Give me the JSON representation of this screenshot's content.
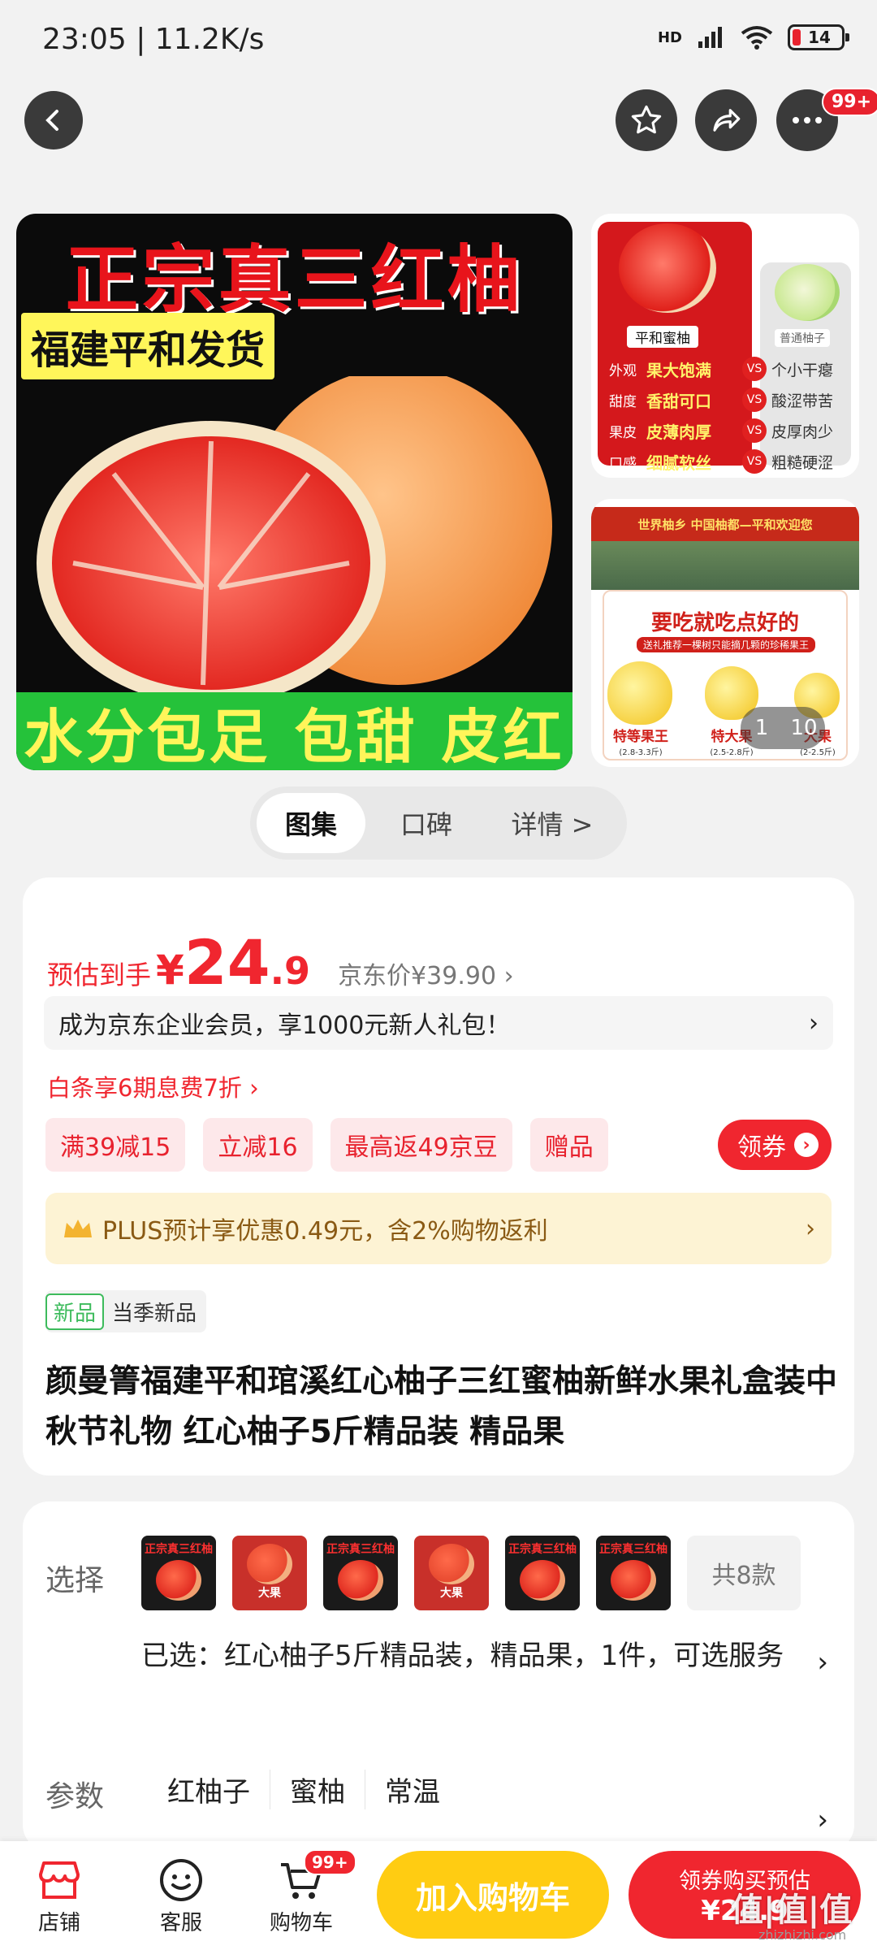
{
  "status": {
    "time": "23:05 | 11.2K/s",
    "network": "HD",
    "battery": "14",
    "battery_color": "#e8222e"
  },
  "topbar": {
    "more_badge": "99+"
  },
  "gallery": {
    "hero_title": "正宗真三红柚",
    "hero_sub": "福建平和发货",
    "hero_bottom": "水分包足 包甜 皮红",
    "thumb1": {
      "left_tag": "平和蜜柚",
      "right_tag": "普通柚子",
      "rows": [
        {
          "k": "外观",
          "v": "果大饱满",
          "o": "个小干瘪"
        },
        {
          "k": "甜度",
          "v": "香甜可口",
          "o": "酸涩带苦"
        },
        {
          "k": "果皮",
          "v": "皮薄肉厚",
          "o": "皮厚肉少"
        },
        {
          "k": "口感",
          "v": "细腻软丝",
          "o": "粗糙硬涩"
        }
      ]
    },
    "thumb2": {
      "banner": "世界柚乡 中国柚都—平和欢迎您",
      "heading": "要吃就吃点好的",
      "subheading": "送礼推荐一棵树只能摘几颗的珍稀果王",
      "grades": [
        {
          "name": "特等果王",
          "weight": "(2.8-3.3斤)"
        },
        {
          "name": "特大果",
          "weight": "(2.5-2.8斤)"
        },
        {
          "name": "大果",
          "weight": "(2-2.5斤)"
        }
      ]
    },
    "pager": {
      "current": "1",
      "total": "10"
    }
  },
  "tabs": [
    {
      "label": "图集"
    },
    {
      "label": "口碑"
    },
    {
      "label": "详情 >"
    }
  ],
  "price": {
    "label": "预估到手",
    "yen": "¥",
    "integer": "24",
    "decimal": ".9",
    "jd_price": "京东价¥39.90 ›"
  },
  "member_banner": {
    "text": "成为京东企业会员，享1000元新人礼包！",
    "arrow": "›"
  },
  "baitiao": "白条享6期息费7折 ›",
  "coupons": [
    "满39减15",
    "立减16",
    "最高返49京豆",
    "赠品"
  ],
  "lingquan": {
    "label": "领券",
    "arrow": "›"
  },
  "plus": {
    "text": "PLUS预计享优惠0.49元，含2%购物返利",
    "arrow": "›"
  },
  "new_tag": {
    "badge": "新品",
    "text": "当季新品"
  },
  "product_title": "颜曼箐福建平和琯溪红心柚子三红蜜柚新鲜水果礼盒装中秋节礼物 红心柚子5斤精品装 精品果",
  "selection": {
    "label": "选择",
    "swatch_caption": "正宗真三红柚",
    "box_caption": "大果",
    "more": "共8款",
    "selected_text": "已选：红心柚子5斤精品装，精品果，1件，可选服务",
    "arrow": "›"
  },
  "params": {
    "label": "参数",
    "items": [
      "红柚子",
      "蜜柚",
      "常温"
    ],
    "arrow": "›"
  },
  "bottombar": {
    "store": "店铺",
    "service": "客服",
    "cart": "购物车",
    "cart_badge": "99+",
    "add_cart": "加入购物车",
    "buy_line1": "领券购买预估",
    "buy_line2": "¥24.9"
  },
  "watermark": {
    "main": "值|值|值",
    "sub": "zhizhizhi.com"
  }
}
